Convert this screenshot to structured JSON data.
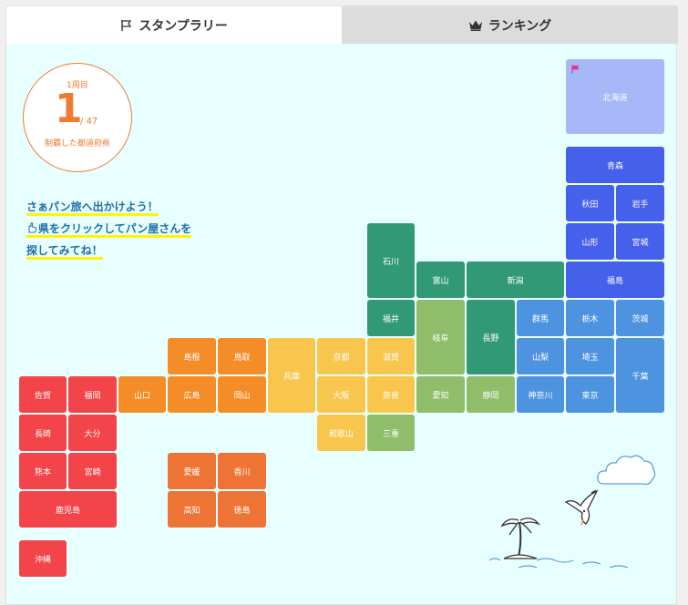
{
  "tabs": [
    {
      "label": "スタンプラリー",
      "icon": "flag-icon",
      "active": true
    },
    {
      "label": "ランキング",
      "icon": "crown-icon",
      "active": false
    }
  ],
  "counter": {
    "lap": "1周目",
    "conquered": "1",
    "total": "/ 47",
    "caption": "制覇した都道府県"
  },
  "intro": {
    "line1": "さぁパン旅へ出かけよう！",
    "line2": "県をクリックしてパン屋さんを",
    "line3": "探してみてね！",
    "pointer_icon": "pointing-hand-icon"
  },
  "colors": {
    "kyushu": "#f34449",
    "chugoku": "#f48d27",
    "shikoku": "#ee7436",
    "kinki": "#f8c64d",
    "tokai": "#8fbd6a",
    "hokuriku": "#329976",
    "kanto": "#4e93e0",
    "tohoku": "#4560ea",
    "hokkaido_conquered": "#a6b8f8",
    "flag": "#e8338a"
  },
  "prefectures": {
    "hokkaido": "北海道",
    "aomori": "青森",
    "akita": "秋田",
    "iwate": "岩手",
    "yamagata": "山形",
    "miyagi": "宮城",
    "fukushima": "福島",
    "niigata": "新潟",
    "toyama": "富山",
    "ishikawa": "石川",
    "fukui": "福井",
    "gifu": "岐阜",
    "nagano": "長野",
    "gunma": "群馬",
    "tochigi": "栃木",
    "ibaraki": "茨城",
    "yamanashi": "山梨",
    "saitama": "埼玉",
    "chiba": "千葉",
    "kanagawa": "神奈川",
    "tokyo": "東京",
    "aichi": "愛知",
    "shizuoka": "静岡",
    "mie": "三重",
    "shiga": "滋賀",
    "kyoto": "京都",
    "osaka": "大阪",
    "nara": "奈良",
    "wakayama": "和歌山",
    "hyogo": "兵庫",
    "shimane": "島根",
    "tottori": "鳥取",
    "hiroshima": "広島",
    "okayama": "岡山",
    "yamaguchi": "山口",
    "ehime": "愛媛",
    "kagawa": "香川",
    "kochi": "高知",
    "tokushima": "徳島",
    "saga": "佐賀",
    "fukuoka": "福岡",
    "nagasaki": "長崎",
    "oita": "大分",
    "kumamoto": "熊本",
    "miyazaki": "宮崎",
    "kagoshima": "鹿児島",
    "okinawa": "沖縄"
  },
  "conquered": [
    "hokkaido"
  ],
  "decorations": [
    "cloud-icon",
    "seagull-icon",
    "palm-island-icon",
    "waves-icon"
  ]
}
